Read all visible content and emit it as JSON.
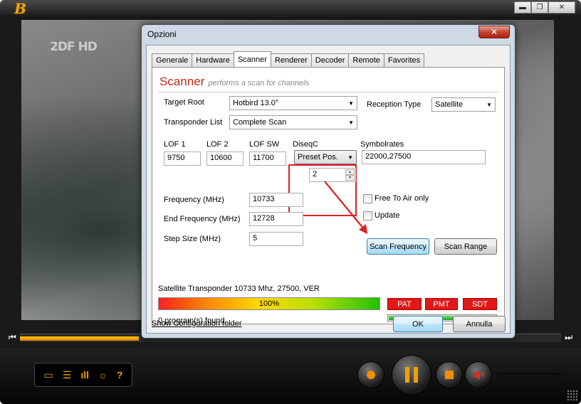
{
  "player": {
    "logo": "B",
    "channel_logo": "2DF HD",
    "window_buttons": {
      "minimize": "▬",
      "restore": "❐",
      "close": "✕"
    },
    "seek_progress": 0.22,
    "seek_left_glyph": "⏮",
    "seek_right_glyph": "⏭",
    "controls": {
      "folder_icon": "▭",
      "list_icon": "☰",
      "eq_icon": "ıll",
      "settings_icon": "☼",
      "help_icon": "?"
    }
  },
  "dialog": {
    "title": "Opzioni",
    "close_glyph": "✕",
    "tabs": [
      "Generale",
      "Hardware",
      "Scanner",
      "Renderer",
      "Decoder",
      "Remote",
      "Favorites"
    ],
    "active_tab": "Scanner",
    "heading": "Scanner",
    "subheading": "performs a scan for channels",
    "target_root_label": "Target Root",
    "target_root_value": "Hotbird 13.0°",
    "reception_type_label": "Reception Type",
    "reception_type_value": "Satellite",
    "transponder_list_label": "Transponder List",
    "transponder_list_value": "Complete Scan",
    "lof1_label": "LOF 1",
    "lof1_value": "9750",
    "lof2_label": "LOF 2",
    "lof2_value": "10600",
    "lofsw_label": "LOF SW",
    "lofsw_value": "11700",
    "diseqc_label": "DiseqC",
    "diseqc_value": "Preset Pos.",
    "diseqc_position": "2",
    "symbolrates_label": "Symbolrates",
    "symbolrates_value": "22000,27500",
    "frequency_label": "Frequency (MHz)",
    "frequency_value": "10733",
    "end_frequency_label": "End Frequency (MHz)",
    "end_frequency_value": "12728",
    "step_size_label": "Step Size (MHz)",
    "step_size_value": "5",
    "free_to_air_label": "Free To Air only",
    "update_label": "Update",
    "scan_frequency_button": "Scan Frequency",
    "scan_range_button": "Scan Range",
    "transponder_status": "Satellite Transponder 10733 Mhz, 27500, VER",
    "progress_value": "100%",
    "signal_level": 0.94,
    "status_tags": [
      "PAT",
      "PMT",
      "SDT"
    ],
    "programs_found": "0 program(s) found..",
    "config_link": "Show Configuration folder",
    "ok_button": "OK",
    "cancel_button": "Annulla"
  },
  "colors": {
    "heading": "#c02818",
    "annotation": "#e02020",
    "accent": "#f0a000"
  }
}
